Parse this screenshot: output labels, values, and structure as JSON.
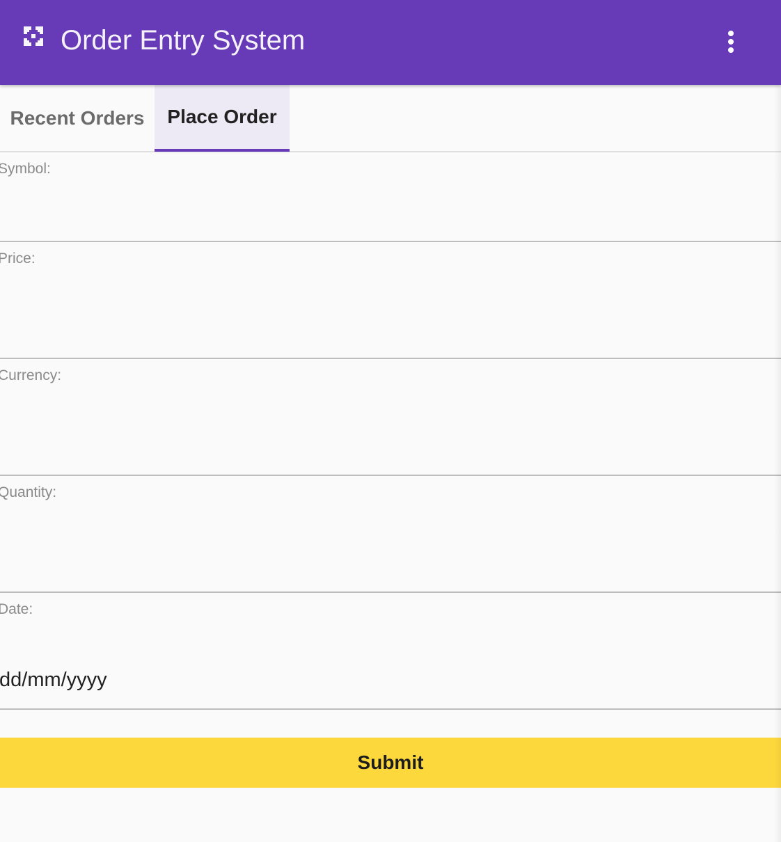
{
  "app": {
    "title": "Order Entry System",
    "icon": "app-logo-icon",
    "menu_icon": "more-vert-icon"
  },
  "tabs": [
    {
      "label": "Recent Orders",
      "active": false
    },
    {
      "label": "Place Order",
      "active": true
    }
  ],
  "form": {
    "fields": [
      {
        "label": "Symbol:",
        "value": "",
        "placeholder": ""
      },
      {
        "label": "Price:",
        "value": "",
        "placeholder": ""
      },
      {
        "label": "Currency:",
        "value": "",
        "placeholder": ""
      },
      {
        "label": "Quantity:",
        "value": "",
        "placeholder": ""
      },
      {
        "label": "Date:",
        "value": "",
        "placeholder": "dd/mm/yyyy"
      }
    ],
    "submit_label": "Submit"
  },
  "colors": {
    "app_bar": "#673ab7",
    "active_tab_indicator": "#673ab7",
    "active_tab_background": "#ede9f5",
    "submit_button": "#fdd83d",
    "page_background": "#fafafa"
  }
}
